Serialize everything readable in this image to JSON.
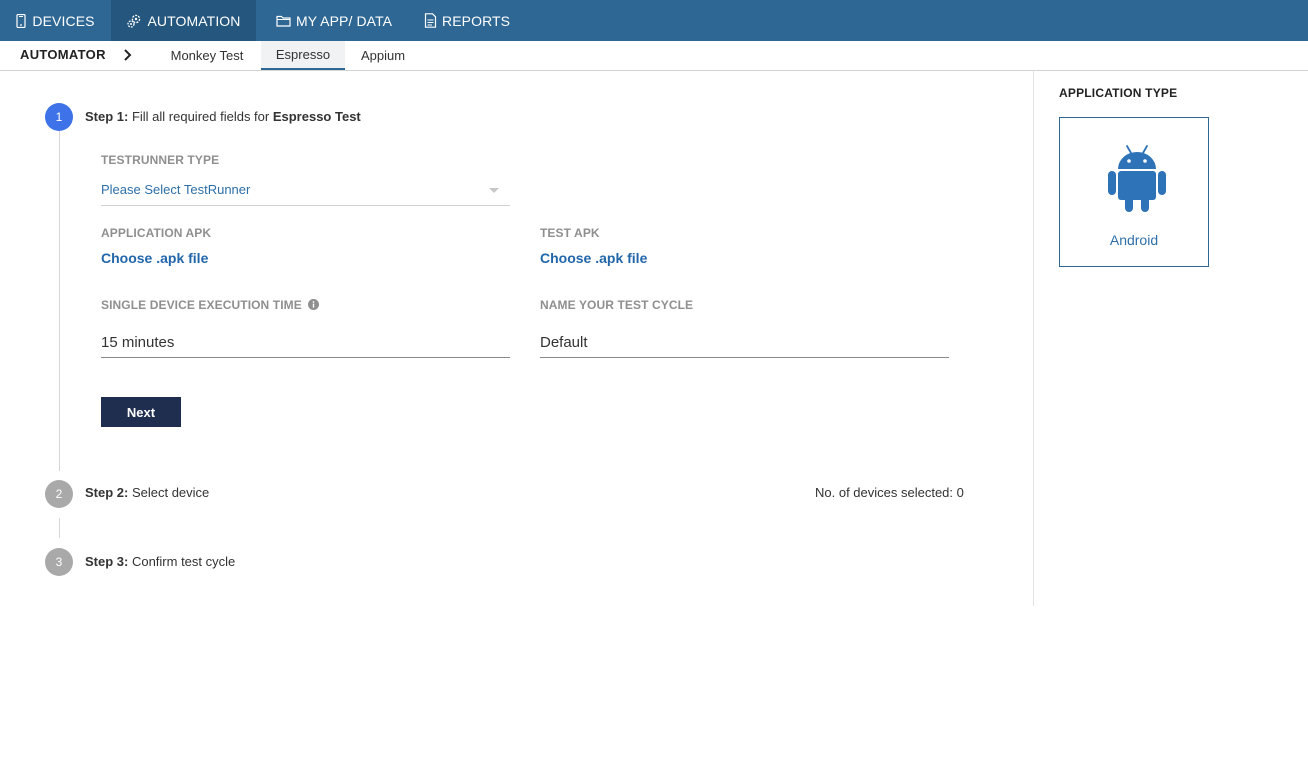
{
  "topnav": {
    "tabs": [
      {
        "label": "DEVICES",
        "icon": "phone-icon"
      },
      {
        "label": "AUTOMATION",
        "icon": "gears-icon",
        "active": true
      },
      {
        "label": "MY APP/ DATA",
        "icon": "folder-icon"
      },
      {
        "label": "REPORTS",
        "icon": "document-icon"
      }
    ]
  },
  "subnav": {
    "breadcrumb": "AUTOMATOR",
    "tabs": [
      {
        "label": "Monkey Test"
      },
      {
        "label": "Espresso",
        "active": true
      },
      {
        "label": "Appium"
      }
    ]
  },
  "steps": {
    "step1": {
      "number": "1",
      "prefix": "Step 1:",
      "text": " Fill all required fields for ",
      "bold": "Espresso Test"
    },
    "step2": {
      "number": "2",
      "prefix": "Step 2:",
      "text": " Select device"
    },
    "step3": {
      "number": "3",
      "prefix": "Step 3:",
      "text": " Confirm test cycle"
    }
  },
  "form": {
    "testrunner_label": "TESTRUNNER TYPE",
    "testrunner_placeholder": "Please Select TestRunner",
    "app_apk_label": "APPLICATION APK",
    "app_apk_link": "Choose .apk file",
    "test_apk_label": "TEST APK",
    "test_apk_link": "Choose .apk file",
    "exec_time_label": "SINGLE DEVICE EXECUTION TIME",
    "exec_time_value": "15 minutes",
    "cycle_name_label": "NAME YOUR TEST CYCLE",
    "cycle_name_value": "Default",
    "next_label": "Next"
  },
  "device_count": "No. of devices selected: 0",
  "app_type": {
    "title": "APPLICATION TYPE",
    "label": "Android",
    "icon": "android-icon"
  },
  "colors": {
    "nav_bg": "#2e6794",
    "nav_active": "#24567e",
    "step_active": "#3d72e8",
    "step_idle": "#a9a9a9",
    "button_bg": "#1f2d4e",
    "link": "#2266aa",
    "android_blue": "#2e72b8"
  }
}
